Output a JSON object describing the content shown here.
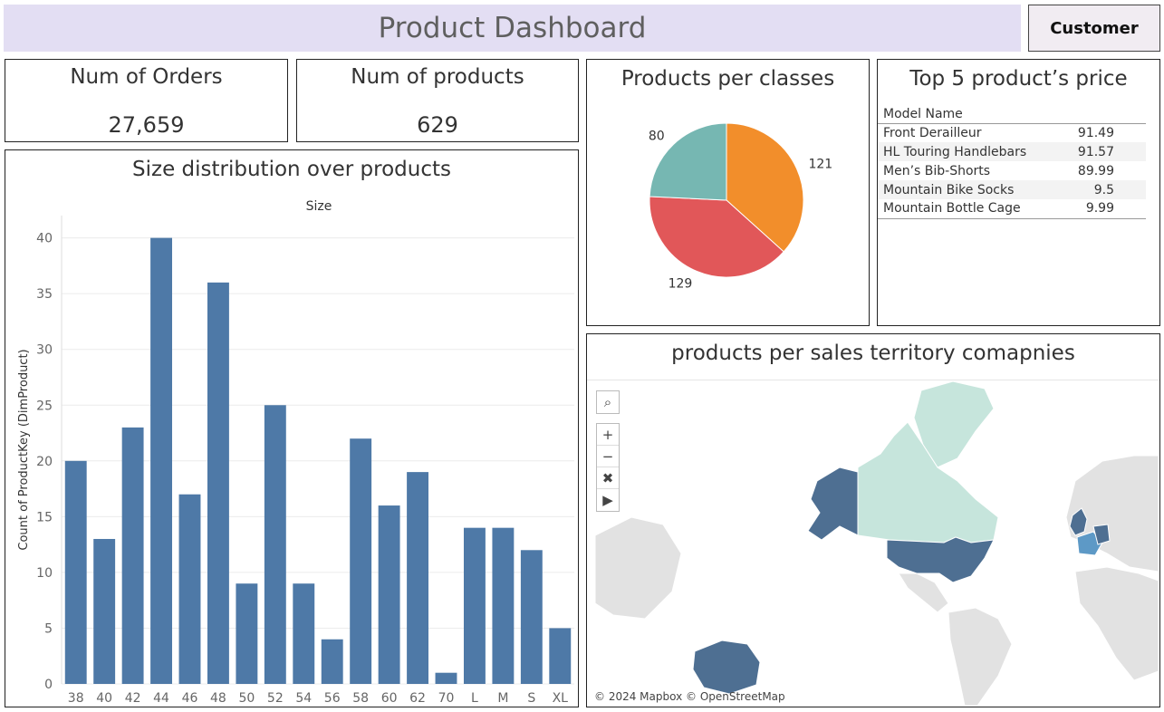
{
  "dashboard": {
    "title": "Product Dashboard",
    "customer_button": "Customer"
  },
  "kpis": [
    {
      "label": "Num of Orders",
      "value": "27,659"
    },
    {
      "label": "Num of products",
      "value": "629"
    }
  ],
  "pie": {
    "title": "Products per classes",
    "colors": [
      "#f28e2b",
      "#e15759",
      "#76b7b2"
    ]
  },
  "top_prices": {
    "title": "Top 5 product’s price",
    "column_header": "Model Name",
    "rows": [
      {
        "name": "Front Derailleur",
        "price": "91.49"
      },
      {
        "name": "HL Touring Handlebars",
        "price": "91.57"
      },
      {
        "name": "Men’s Bib-Shorts",
        "price": "89.99"
      },
      {
        "name": "Mountain Bike Socks",
        "price": "9.5"
      },
      {
        "name": "Mountain Bottle Cage",
        "price": "9.99"
      }
    ]
  },
  "bar": {
    "title": "Size distribution over products",
    "bar_color": "#4e79a7"
  },
  "map": {
    "title": "products per sales territory comapnies",
    "attribution": "© 2024 Mapbox © OpenStreetMap",
    "controls": {
      "search": "⌕",
      "zoom_in": "+",
      "zoom_out": "−",
      "pin": "✖",
      "play": "▶"
    },
    "colors": {
      "land": "#e2e2e2",
      "canada": "#c6e5dc",
      "dark": "#4e6f92",
      "teal": "#5d99c6"
    }
  },
  "chart_data": [
    {
      "type": "pie",
      "title": "Products per classes",
      "values": [
        121,
        129,
        80
      ]
    },
    {
      "type": "bar",
      "title": "Size distribution over products",
      "xlabel": "Size",
      "ylabel": "Count of ProductKey (DimProduct)",
      "categories": [
        "38",
        "40",
        "42",
        "44",
        "46",
        "48",
        "50",
        "52",
        "54",
        "56",
        "58",
        "60",
        "62",
        "70",
        "L",
        "M",
        "S",
        "XL"
      ],
      "values": [
        20,
        13,
        23,
        40,
        17,
        36,
        9,
        25,
        9,
        4,
        22,
        16,
        19,
        1,
        14,
        14,
        12,
        5
      ],
      "ylim": [
        0,
        42
      ],
      "yticks": [
        0,
        5,
        10,
        15,
        20,
        25,
        30,
        35,
        40
      ],
      "grid": true
    }
  ]
}
